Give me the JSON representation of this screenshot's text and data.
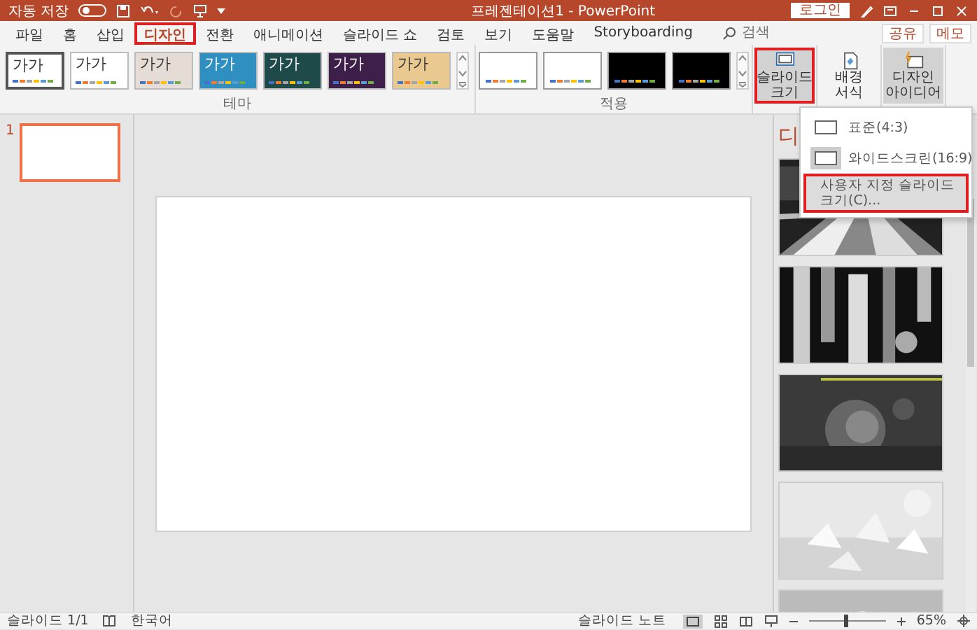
{
  "title_bar": {
    "autosave_label": "자동 저장",
    "autosave_on": false,
    "title": "프레젠테이션1 - PowerPoint",
    "login": "로그인"
  },
  "tabs": [
    {
      "label": "파일",
      "selected": false,
      "highlighted": false
    },
    {
      "label": "홈",
      "selected": false,
      "highlighted": false
    },
    {
      "label": "삽입",
      "selected": false,
      "highlighted": false
    },
    {
      "label": "디자인",
      "selected": true,
      "highlighted": true
    },
    {
      "label": "전환",
      "selected": false,
      "highlighted": false
    },
    {
      "label": "애니메이션",
      "selected": false,
      "highlighted": false
    },
    {
      "label": "슬라이드 쇼",
      "selected": false,
      "highlighted": false
    },
    {
      "label": "검토",
      "selected": false,
      "highlighted": false
    },
    {
      "label": "보기",
      "selected": false,
      "highlighted": false
    },
    {
      "label": "도움말",
      "selected": false,
      "highlighted": false
    },
    {
      "label": "Storyboarding",
      "selected": false,
      "highlighted": false
    }
  ],
  "search": {
    "placeholder": "검색"
  },
  "share": "공유",
  "memo": "메모",
  "themes": {
    "label": "테마",
    "items": [
      {
        "sample": "가가",
        "selected": true,
        "color": "#ffffff"
      },
      {
        "sample": "가가",
        "selected": false,
        "color": "#ffffff"
      },
      {
        "sample": "가가",
        "selected": false,
        "color": "#e6dcd6"
      },
      {
        "sample": "가가",
        "selected": false,
        "color": "#2e8fc0"
      },
      {
        "sample": "가가",
        "selected": false,
        "color": "#1f4a4a"
      },
      {
        "sample": "가가",
        "selected": false,
        "color": "#3d1f4a"
      },
      {
        "sample": "가가",
        "selected": false,
        "color": "#e9c98f"
      }
    ]
  },
  "variants": {
    "label": "적용",
    "items": [
      {
        "color": "#ffffff"
      },
      {
        "color": "#ffffff"
      },
      {
        "color": "#000000"
      },
      {
        "color": "#000000"
      }
    ]
  },
  "ribbon_buttons": [
    {
      "label": "슬라이드 크기",
      "kind": "size",
      "selected": true,
      "highlighted": true
    },
    {
      "label": "배경 서식",
      "kind": "background",
      "selected": false,
      "highlighted": false
    },
    {
      "label": "디자인 아이디어",
      "kind": "ideas",
      "selected": true,
      "highlighted": false
    }
  ],
  "size_menu": [
    {
      "label": "표준(4:3)",
      "kind": "option",
      "selected": false,
      "highlighted": false
    },
    {
      "label": "와이드스크린(16:9)",
      "kind": "option",
      "selected": true,
      "highlighted": false
    },
    {
      "label": "사용자 지정 슬라이드 크기(C)...",
      "kind": "command",
      "highlighted": true
    }
  ],
  "slides": [
    {
      "number": "1",
      "selected": true
    }
  ],
  "designer": {
    "title": "디"
  },
  "status_bar": {
    "slide": "슬라이드 1/1",
    "language": "한국어",
    "notes": "슬라이드 노트",
    "zoom": "65%",
    "level": 0.45
  }
}
